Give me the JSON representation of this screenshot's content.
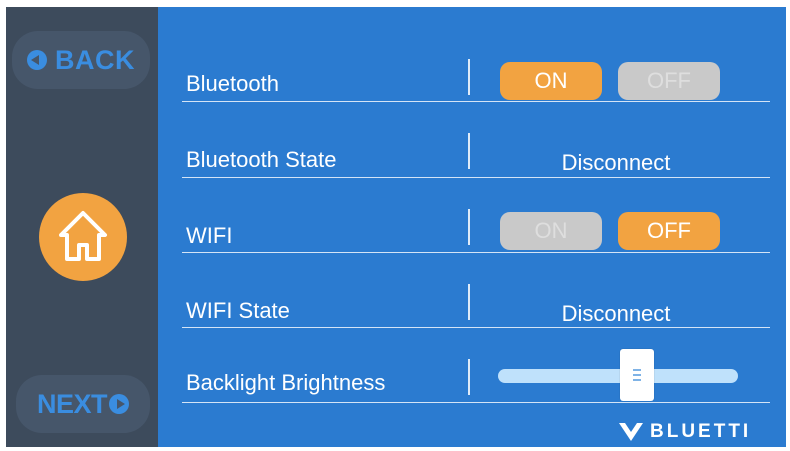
{
  "nav": {
    "back_label": "BACK",
    "next_label": "NEXT"
  },
  "settings": {
    "bluetooth": {
      "label": "Bluetooth",
      "on_label": "ON",
      "off_label": "OFF",
      "state": "ON"
    },
    "bluetooth_state": {
      "label": "Bluetooth State",
      "value": "Disconnect"
    },
    "wifi": {
      "label": "WIFI",
      "on_label": "ON",
      "off_label": "OFF",
      "state": "OFF"
    },
    "wifi_state": {
      "label": "WIFI State",
      "value": "Disconnect"
    },
    "backlight": {
      "label": "Backlight Brightness",
      "level_fraction": 0.58
    }
  },
  "brand": {
    "name": "BLUETTI"
  },
  "colors": {
    "screen_bg": "#2b7bd0",
    "sidebar_bg": "#3d4b5c",
    "accent_orange": "#f2a341",
    "inactive_gray": "#c9c9c9",
    "nav_text_blue": "#3a8de0"
  },
  "icons": {
    "back": "back-arrow-circle-icon",
    "next": "next-arrow-circle-icon",
    "home": "home-icon",
    "brand": "bluetti-logo-icon"
  }
}
